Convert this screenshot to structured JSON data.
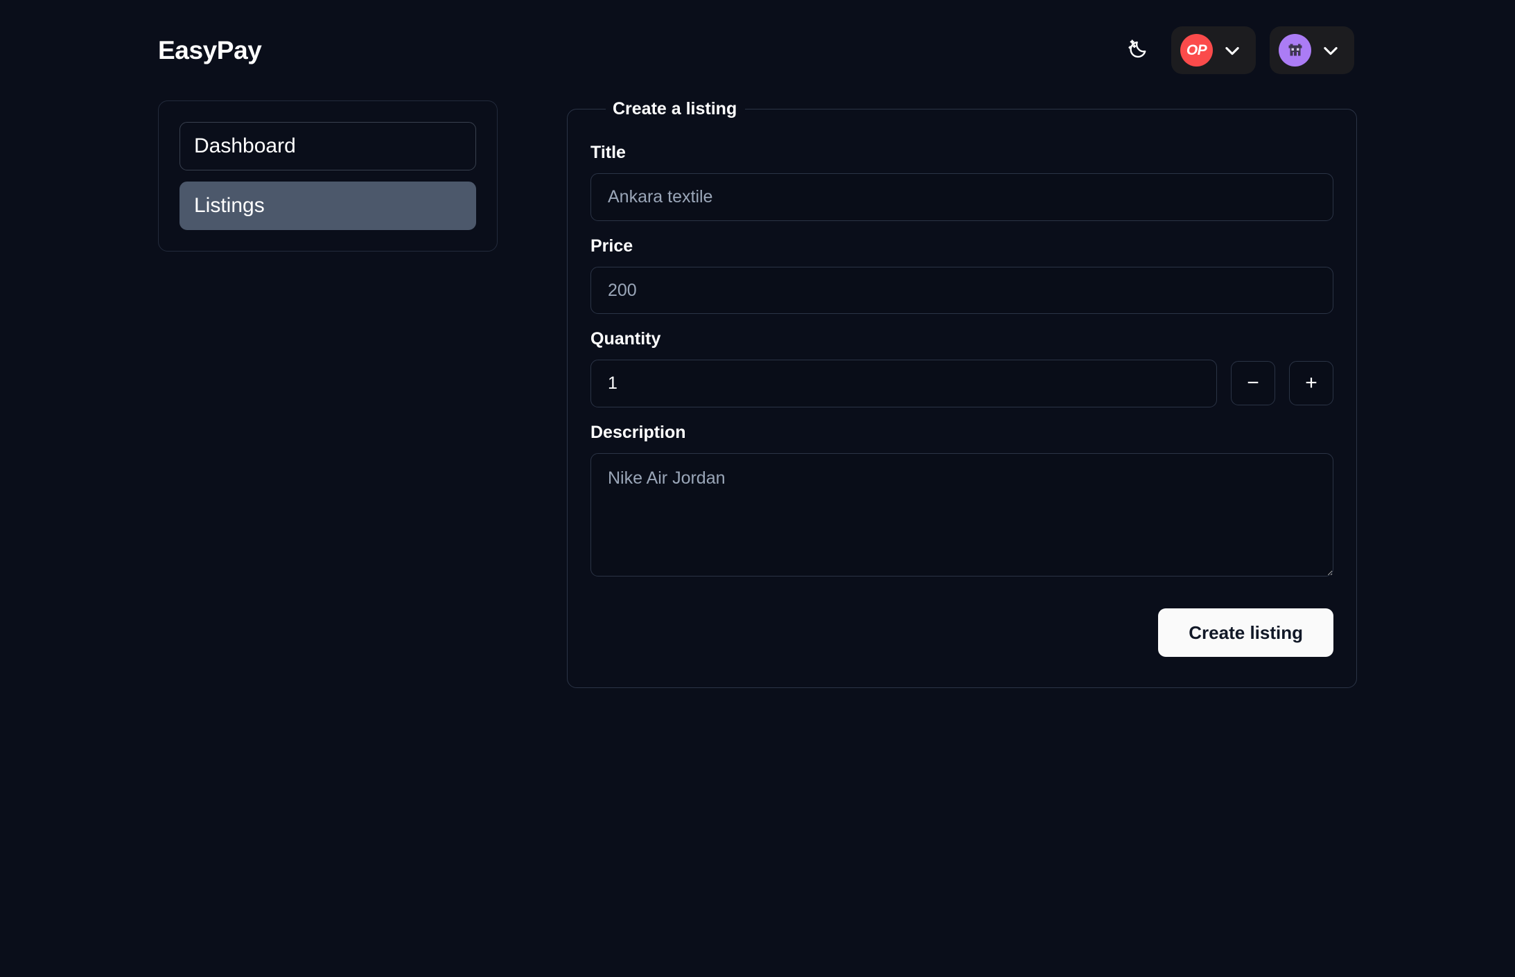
{
  "app": {
    "brand": "EasyPay",
    "background_color": "#0a0e1a"
  },
  "topbar": {
    "theme_toggle": {
      "icon": "moon-stars-icon",
      "label": "Toggle dark mode"
    },
    "account_menu": {
      "avatar_initials": "OP",
      "avatar_color": "#fb4b4b",
      "chevron": "chevron-down-icon"
    },
    "profile_menu": {
      "avatar_icon": "alien-avatar-icon",
      "avatar_color": "#ab7cf5",
      "chevron": "chevron-down-icon"
    }
  },
  "sidebar": {
    "items": [
      {
        "label": "Dashboard",
        "active": false
      },
      {
        "label": "Listings",
        "active": true
      }
    ],
    "active_color": "#4c586b"
  },
  "form": {
    "legend": "Create a listing",
    "fields": {
      "title": {
        "label": "Title",
        "value": "",
        "placeholder": "Ankara textile"
      },
      "price": {
        "label": "Price",
        "value": "",
        "placeholder": "200"
      },
      "quantity": {
        "label": "Quantity",
        "value": "1",
        "placeholder": "1",
        "decrement_label": "−",
        "increment_label": "+"
      },
      "description": {
        "label": "Description",
        "value": "",
        "placeholder": "Nike Air Jordan"
      }
    },
    "submit_label": "Create listing"
  }
}
